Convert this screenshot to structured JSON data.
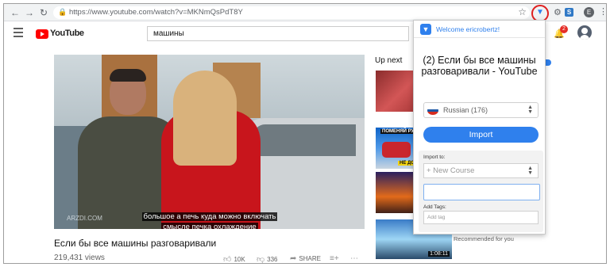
{
  "browser": {
    "url": "https://www.youtube.com/watch?v=MKNmQsPdT8Y",
    "profile_initial": "E",
    "extension_s_label": "S"
  },
  "youtube": {
    "logo_text": "YouTube",
    "search_value": "машины",
    "notification_count": "2"
  },
  "video": {
    "subtitle_line1": "большое а печь куда можно включать",
    "subtitle_line2": "смысле печка охлаждение",
    "watermark": "ARZDI.COM",
    "title": "Если бы все машины разговаривали",
    "views": "219,431 views",
    "likes": "10K",
    "dislikes": "336",
    "share_label": "SHARE"
  },
  "sidebar": {
    "up_next_label": "Up next",
    "thumb2_caption_top": "ПОМЕНЯЙ РУЛЬ",
    "thumb2_caption_bottom": "НЕ ДОЖДЁШЬСЯ",
    "thumb4_duration": "1:08:11",
    "recommended_label": "Recommended for you"
  },
  "popup": {
    "welcome": "Welcome ericrobertz!",
    "page_title": "(2) Если бы все машины разговаривали - YouTube",
    "language": "Russian (176)",
    "import_button": "Import",
    "import_to_label": "Import to:",
    "course_option": "+ New Course",
    "tags_label": "Add Tags:",
    "tags_placeholder": "Add tag"
  },
  "colors": {
    "accent": "#2f80ed",
    "youtube_red": "#ff0000",
    "highlight_ring": "#e02020"
  },
  "icons": {
    "back": "arrow-left-icon",
    "forward": "arrow-right-icon",
    "reload": "reload-icon",
    "lock": "lock-icon",
    "bookmark": "star-icon",
    "extension": "funnel-icon",
    "settings": "gear-icon",
    "menu": "hamburger-icon",
    "notifications": "bell-icon"
  }
}
